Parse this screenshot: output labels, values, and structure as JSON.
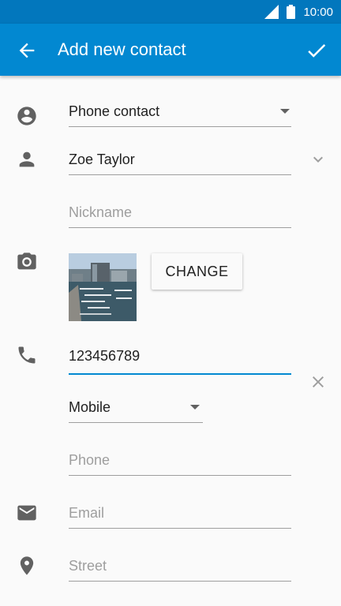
{
  "status_bar": {
    "time": "10:00"
  },
  "app_bar": {
    "title": "Add new contact"
  },
  "form": {
    "account": {
      "value": "Phone contact"
    },
    "name": {
      "value": "Zoe Taylor"
    },
    "nickname": {
      "placeholder": "Nickname"
    },
    "photo": {
      "change_label": "CHANGE"
    },
    "phone": {
      "value": "123456789"
    },
    "phone_type": {
      "value": "Mobile"
    },
    "phone2": {
      "placeholder": "Phone"
    },
    "email": {
      "placeholder": "Email"
    },
    "street": {
      "placeholder": "Street"
    }
  },
  "colors": {
    "status_bar": "#0277bd",
    "app_bar": "#0288d1",
    "accent": "#0288d1",
    "icon": "#616161"
  }
}
